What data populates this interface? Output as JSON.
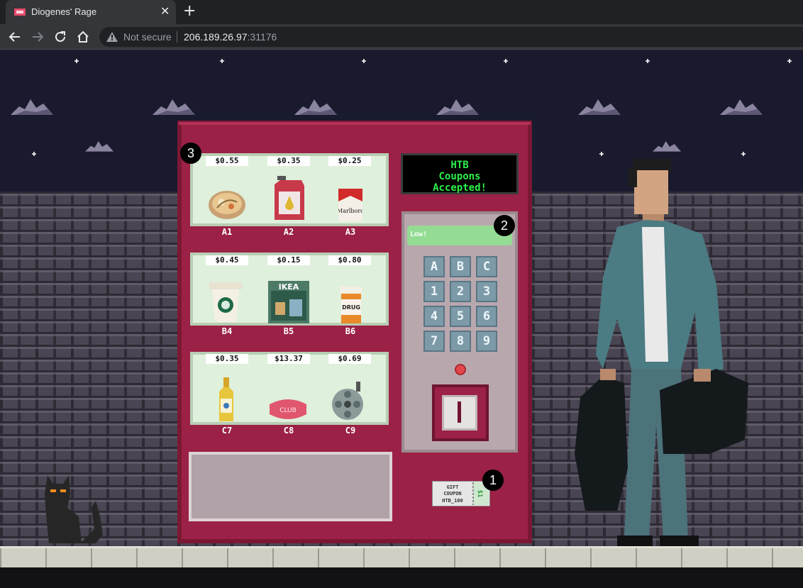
{
  "browser": {
    "tab_title": "Diogenes' Rage",
    "tab_close": "✕",
    "new_tab": "+",
    "not_secure": "Not secure",
    "url_host": "206.189.26.97",
    "url_port": ":31176"
  },
  "machine": {
    "display_lines": [
      "HTB",
      "Coupons",
      "Accepted!"
    ],
    "panel_screen": "Low!",
    "shelves": [
      {
        "items": [
          {
            "price": "$0.55",
            "slot": "A1",
            "icon": "ramen-bowl-icon"
          },
          {
            "price": "$0.35",
            "slot": "A2",
            "icon": "oil-jug-icon"
          },
          {
            "price": "$0.25",
            "slot": "A3",
            "icon": "cigarette-pack-icon"
          }
        ]
      },
      {
        "items": [
          {
            "price": "$0.45",
            "slot": "B4",
            "icon": "coffee-cup-icon"
          },
          {
            "price": "$0.15",
            "slot": "B5",
            "icon": "ikea-catalog-icon"
          },
          {
            "price": "$0.80",
            "slot": "B6",
            "icon": "pill-bottle-icon"
          }
        ]
      },
      {
        "items": [
          {
            "price": "$0.35",
            "slot": "C7",
            "icon": "liquor-bottle-icon"
          },
          {
            "price": "$13.37",
            "slot": "C8",
            "icon": "soap-bar-icon"
          },
          {
            "price": "$0.69",
            "slot": "C9",
            "icon": "film-reel-icon"
          }
        ]
      }
    ],
    "keypad": [
      "A",
      "B",
      "C",
      "1",
      "2",
      "3",
      "4",
      "5",
      "6",
      "7",
      "8",
      "9"
    ],
    "coupon": {
      "line1": "GIFT",
      "line2": "COUPON",
      "line3": "HTB_100",
      "value": "$1"
    },
    "item_texts": {
      "ikea": "IKEA",
      "drug": "DRUG",
      "brand": "Marlboro",
      "soap": "CLUB"
    }
  },
  "markers": [
    "1",
    "2",
    "3"
  ],
  "colors": {
    "machine_body": "#9b2146",
    "shelf_bg": "#dff0dc",
    "display_text": "#2ef04a",
    "keypad_key": "#7c9aa8",
    "panel_screen": "#94dc94"
  }
}
